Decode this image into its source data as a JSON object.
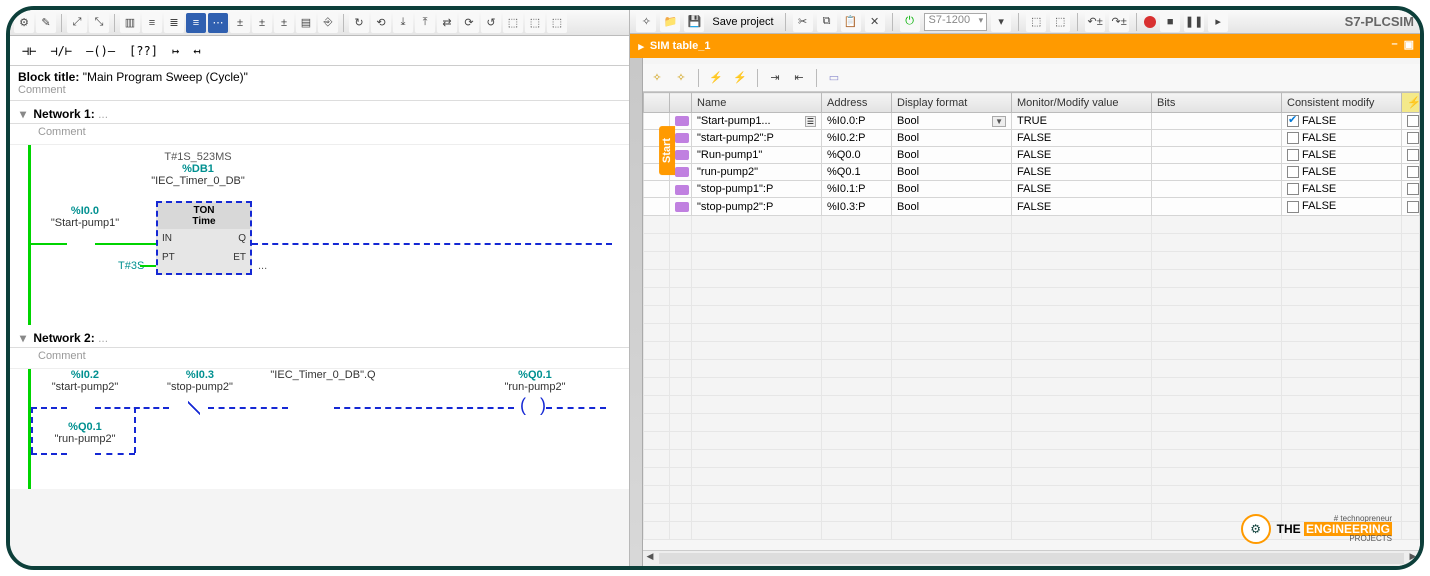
{
  "app": {
    "title_right": "S7-PLCSIM"
  },
  "right_toolbar": {
    "save_label": "Save project",
    "device_select": "S7-1200"
  },
  "left": {
    "block_title_label": "Block title:",
    "block_title_value": "\"Main Program Sweep (Cycle)\"",
    "comment_label": "Comment",
    "network1_label": "Network 1:",
    "network2_label": "Network 2:",
    "ton": {
      "et_label": "T#1S_523MS",
      "db_label": "%DB1",
      "db_name": "\"IEC_Timer_0_DB\"",
      "type1": "TON",
      "type2": "Time",
      "in": "IN",
      "q": "Q",
      "pt": "PT",
      "et": "ET",
      "pt_val": "T#3S",
      "et_val": "..."
    },
    "contacts": {
      "start1_addr": "%I0.0",
      "start1_name": "\"Start-pump1\"",
      "start2_addr": "%I0.2",
      "start2_name": "\"start-pump2\"",
      "stop2_addr": "%I0.3",
      "stop2_name": "\"stop-pump2\"",
      "timerq_name": "\"IEC_Timer_0_DB\".Q",
      "runp2_addr": "%Q0.1",
      "runp2_name": "\"run-pump2\"",
      "runp2b_addr": "%Q0.1",
      "runp2b_name": "\"run-pump2\""
    }
  },
  "sim_tab_title": "SIM table_1",
  "sidebar_tab": "Start",
  "sim_columns": {
    "name": "Name",
    "address": "Address",
    "display": "Display format",
    "mon": "Monitor/Modify value",
    "bits": "Bits",
    "consistent": "Consistent modify"
  },
  "sim_rows": [
    {
      "name": "\"Start-pump1...",
      "addr": "%I0.0:P",
      "disp": "Bool",
      "mon": "TRUE",
      "cm_check": true,
      "cm": "FALSE",
      "sel": true
    },
    {
      "name": "\"start-pump2\":P",
      "addr": "%I0.2:P",
      "disp": "Bool",
      "mon": "FALSE",
      "cm_check": false,
      "cm": "FALSE",
      "sel": false
    },
    {
      "name": "\"Run-pump1\"",
      "addr": "%Q0.0",
      "disp": "Bool",
      "mon": "FALSE",
      "cm_check": false,
      "cm": "FALSE",
      "sel": false
    },
    {
      "name": "\"run-pump2\"",
      "addr": "%Q0.1",
      "disp": "Bool",
      "mon": "FALSE",
      "cm_check": false,
      "cm": "FALSE",
      "sel": false
    },
    {
      "name": "\"stop-pump1\":P",
      "addr": "%I0.1:P",
      "disp": "Bool",
      "mon": "FALSE",
      "cm_check": false,
      "cm": "FALSE",
      "sel": false
    },
    {
      "name": "\"stop-pump2\":P",
      "addr": "%I0.3:P",
      "disp": "Bool",
      "mon": "FALSE",
      "cm_check": false,
      "cm": "FALSE",
      "sel": false
    }
  ],
  "branding": {
    "hash": "# technopreneur",
    "the": "THE",
    "eng": "ENGINEERING",
    "proj": "PROJECTS"
  }
}
